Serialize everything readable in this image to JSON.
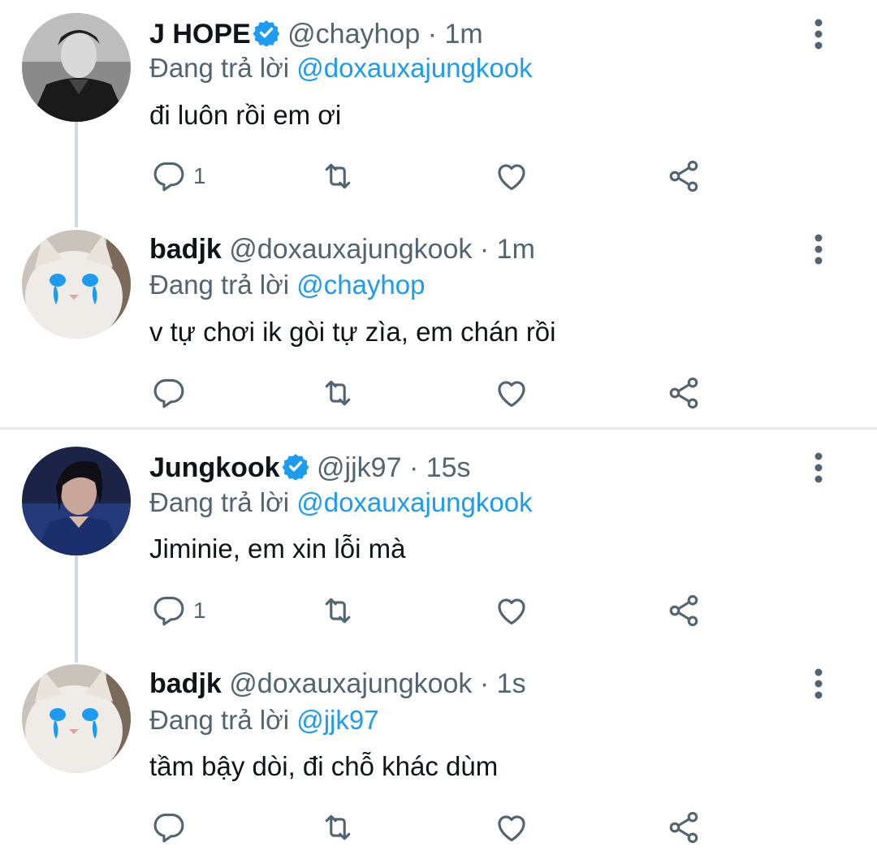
{
  "tweets": [
    {
      "name": "J HOPE",
      "verified": true,
      "handle": "@chayhop",
      "time": "· 1m",
      "reply_prefix": "Đang trả lời",
      "reply_to": "@doxauxajungkook",
      "text": "đi luôn rồi em ơi",
      "reply_count": "1",
      "avatar": "man-portrait-grayscale"
    },
    {
      "name": "badjk",
      "verified": false,
      "handle": "@doxauxajungkook",
      "time": "· 1m",
      "reply_prefix": "Đang trả lời",
      "reply_to": "@chayhop",
      "text": "v tự chơi ik gòi tự zìa, em chán rồi",
      "reply_count": "",
      "avatar": "crying-cat"
    },
    {
      "name": "Jungkook",
      "verified": true,
      "handle": "@jjk97",
      "time": "· 15s",
      "reply_prefix": "Đang trả lời",
      "reply_to": "@doxauxajungkook",
      "text": "Jiminie, em xin lỗi mà",
      "reply_count": "1",
      "avatar": "man-portrait-blue"
    },
    {
      "name": "badjk",
      "verified": false,
      "handle": "@doxauxajungkook",
      "time": "· 1s",
      "reply_prefix": "Đang trả lời",
      "reply_to": "@jjk97",
      "text": "tầm bậy dòi, đi chỗ khác dùm",
      "reply_count": "",
      "avatar": "crying-cat"
    }
  ],
  "icons": {
    "reply": "reply-icon",
    "retweet": "retweet-icon",
    "like": "like-icon",
    "share": "share-icon",
    "more": "more-icon",
    "verified": "verified-badge-icon"
  },
  "colors": {
    "accent": "#1d9bf0",
    "secondary_text": "#536471",
    "thread_line": "#cfd9de",
    "divider": "#e6ecf0"
  }
}
